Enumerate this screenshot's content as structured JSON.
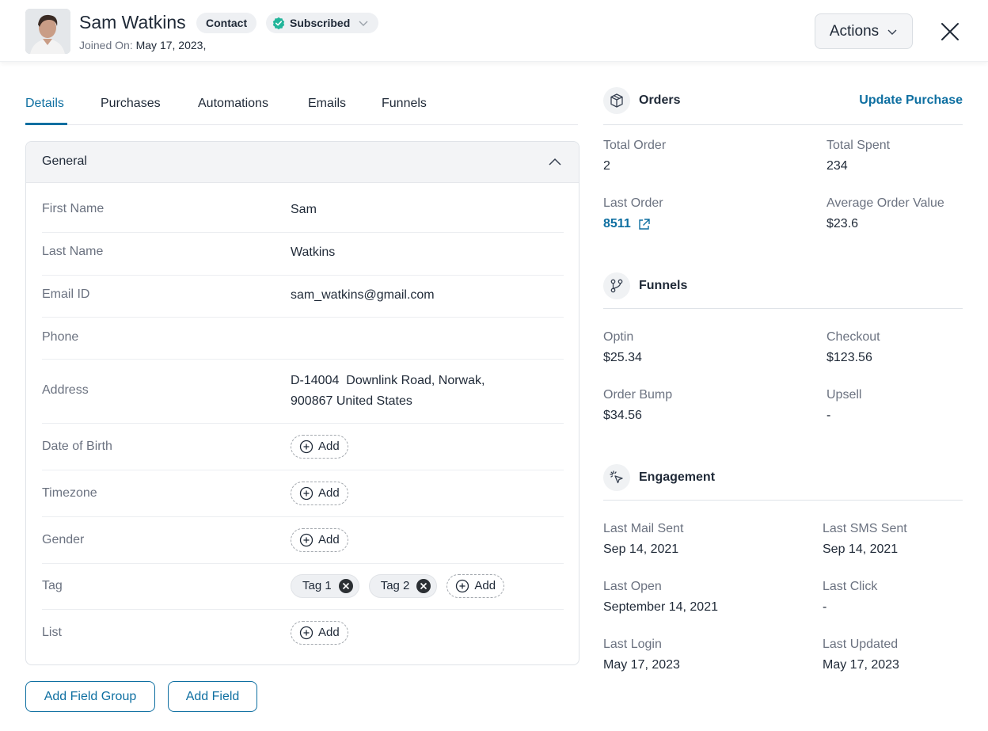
{
  "header": {
    "name": "Sam Watkins",
    "contact_badge": "Contact",
    "status_badge": "Subscribed",
    "joined_label": "Joined On:",
    "joined_value": "May 17, 2023,",
    "actions_label": "Actions"
  },
  "tabs": [
    {
      "label": "Details"
    },
    {
      "label": "Purchases"
    },
    {
      "label": "Automations"
    },
    {
      "label": "Emails"
    },
    {
      "label": "Funnels"
    }
  ],
  "general": {
    "title": "General",
    "add_label": "Add",
    "first_name_label": "First Name",
    "first_name_value": "Sam",
    "last_name_label": "Last Name",
    "last_name_value": "Watkins",
    "email_label": "Email ID",
    "email_value": "sam_watkins@gmail.com",
    "phone_label": "Phone",
    "address_label": "Address",
    "address_line1": "D-14004  Downlink Road, Norwak,",
    "address_line2": "900867 United States",
    "dob_label": "Date of Birth",
    "timezone_label": "Timezone",
    "gender_label": "Gender",
    "tag_label": "Tag",
    "tags": [
      "Tag 1",
      "Tag 2"
    ],
    "list_label": "List"
  },
  "buttons": {
    "add_field_group": "Add Field Group",
    "add_field": "Add Field"
  },
  "orders": {
    "title": "Orders",
    "link": "Update Purchase",
    "total_order_label": "Total Order",
    "total_order_value": "2",
    "total_spent_label": "Total Spent",
    "total_spent_value": "234",
    "last_order_label": "Last Order",
    "last_order_value": "8511",
    "aov_label": "Average Order Value",
    "aov_value": "$23.6"
  },
  "funnels": {
    "title": "Funnels",
    "optin_label": "Optin",
    "optin_value": "$25.34",
    "checkout_label": "Checkout",
    "checkout_value": "$123.56",
    "bump_label": "Order Bump",
    "bump_value": "$34.56",
    "upsell_label": "Upsell",
    "upsell_value": "-"
  },
  "engagement": {
    "title": "Engagement",
    "mail_label": "Last Mail Sent",
    "mail_value": "Sep 14, 2021",
    "sms_label": "Last SMS Sent",
    "sms_value": "Sep 14, 2021",
    "open_label": "Last Open",
    "open_value": "September 14, 2021",
    "click_label": "Last Click",
    "click_value": "-",
    "login_label": "Last Login",
    "login_value": "May 17, 2023",
    "updated_label": "Last Updated",
    "updated_value": "May 17, 2023"
  },
  "colors": {
    "accent": "#0e6fa1",
    "verified": "#22b59a"
  }
}
